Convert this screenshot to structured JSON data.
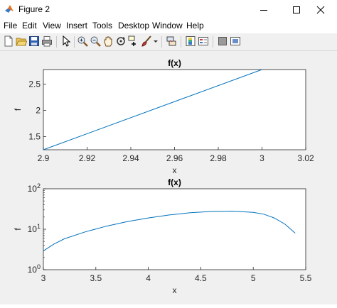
{
  "window": {
    "title": "Figure 2"
  },
  "menu": [
    "File",
    "Edit",
    "View",
    "Insert",
    "Tools",
    "Desktop",
    "Window",
    "Help"
  ],
  "toolbar": {
    "icons": [
      "new-figure-icon",
      "open-file-icon",
      "save-icon",
      "print-icon",
      "edit-plot-arrow-icon",
      "zoom-in-icon",
      "zoom-out-icon",
      "pan-hand-icon",
      "rotate-3d-icon",
      "data-cursor-icon",
      "brush-icon",
      "brush-dropdown-icon",
      "link-plot-icon",
      "insert-colorbar-icon",
      "insert-legend-icon",
      "hide-plot-tools-icon",
      "show-plot-tools-icon"
    ]
  },
  "chart_data": [
    {
      "type": "line",
      "title": "f(x)",
      "xlabel": "x",
      "ylabel": "f",
      "xlim": [
        2.9,
        3.02
      ],
      "ylim": [
        1.25,
        2.78
      ],
      "xticks": [
        "2.9",
        "2.92",
        "2.94",
        "2.96",
        "2.98",
        "3",
        "3.02"
      ],
      "yticks": [
        "1.5",
        "2",
        "2.5"
      ],
      "grid": false,
      "x": [
        2.9,
        3.0
      ],
      "y": [
        1.25,
        2.78
      ]
    },
    {
      "type": "line",
      "title": "f(x)",
      "xlabel": "x",
      "ylabel": "f",
      "yscale": "log",
      "xlim": [
        3,
        5.5
      ],
      "ylim": [
        1,
        100
      ],
      "xticks": [
        "3",
        "3.5",
        "4",
        "4.5",
        "5",
        "5.5"
      ],
      "yticks": [
        {
          "base": "10",
          "exp": "0"
        },
        {
          "base": "10",
          "exp": "1"
        },
        {
          "base": "10",
          "exp": "2"
        }
      ],
      "grid": false,
      "x": [
        3.0,
        3.1,
        3.2,
        3.4,
        3.6,
        3.8,
        4.0,
        4.2,
        4.4,
        4.6,
        4.8,
        5.0,
        5.1,
        5.2,
        5.3,
        5.4
      ],
      "y": [
        2.9,
        4.3,
        5.8,
        8.6,
        11.9,
        15.4,
        19.0,
        22.5,
        25.5,
        27.5,
        28.0,
        26.2,
        23.5,
        19.0,
        13.5,
        8.0
      ]
    }
  ]
}
